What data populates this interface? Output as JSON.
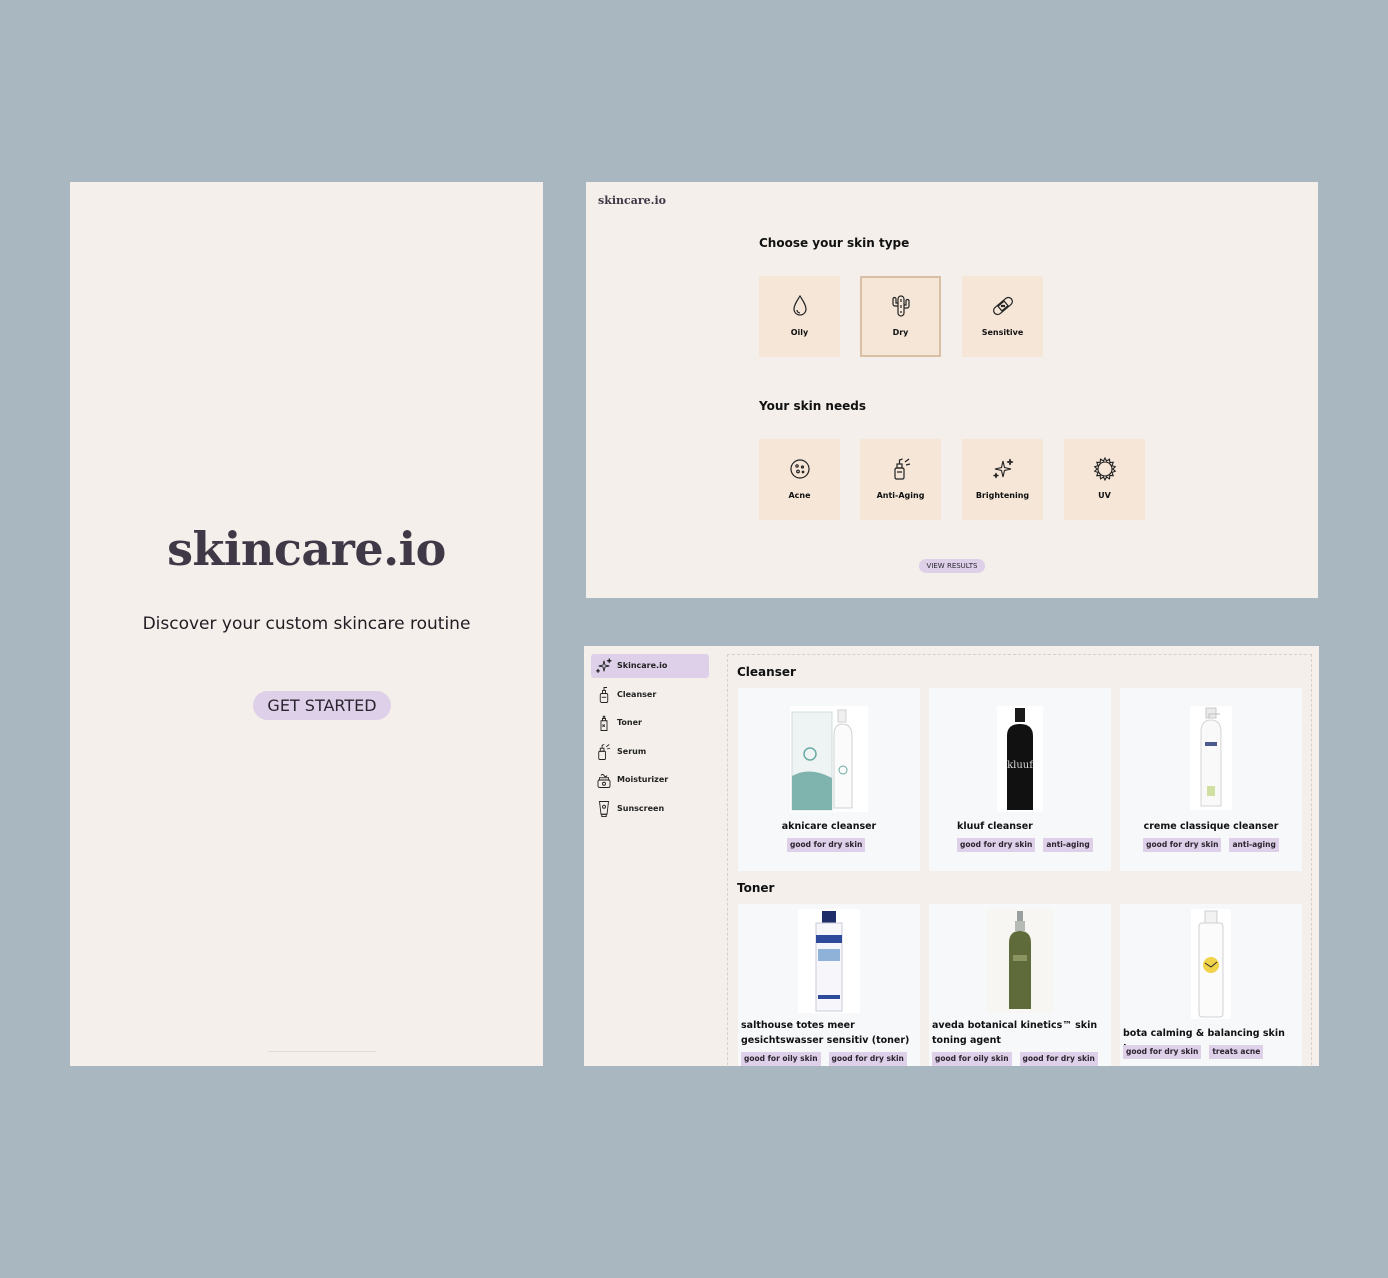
{
  "landing": {
    "logo": "skincare.io",
    "tagline": "Discover your custom skincare routine",
    "cta_label": "GET STARTED"
  },
  "quiz": {
    "brand": "skincare.io",
    "skin_type_heading": "Choose your skin type",
    "skin_types": [
      {
        "label": "Oily",
        "icon": "droplet-icon",
        "selected": false
      },
      {
        "label": "Dry",
        "icon": "cactus-icon",
        "selected": true
      },
      {
        "label": "Sensitive",
        "icon": "bandage-icon",
        "selected": false
      }
    ],
    "skin_needs_heading": "Your skin needs",
    "skin_needs": [
      {
        "label": "Acne",
        "icon": "acne-icon"
      },
      {
        "label": "Anti-Aging",
        "icon": "dropper-bottle-icon"
      },
      {
        "label": "Brightening",
        "icon": "sparkles-icon"
      },
      {
        "label": "UV",
        "icon": "sun-icon"
      }
    ],
    "view_results_label": "VIEW RESULTS"
  },
  "catalog": {
    "nav": [
      {
        "label": "Skincare.io",
        "icon": "sparkles-icon",
        "active": true
      },
      {
        "label": "Cleanser",
        "icon": "cleanser-bottle-icon"
      },
      {
        "label": "Toner",
        "icon": "toner-bottle-icon"
      },
      {
        "label": "Serum",
        "icon": "serum-dropper-icon"
      },
      {
        "label": "Moisturizer",
        "icon": "moisturizer-jar-icon"
      },
      {
        "label": "Sunscreen",
        "icon": "sunscreen-tube-icon"
      }
    ],
    "sections": [
      {
        "title": "Cleanser",
        "products": [
          {
            "name": "aknicare cleanser",
            "tags": [
              "good for dry skin"
            ]
          },
          {
            "name": "kluuf cleanser",
            "tags": [
              "good for dry skin",
              "anti-aging"
            ]
          },
          {
            "name": "creme classique cleanser",
            "tags": [
              "good for dry skin",
              "anti-aging"
            ]
          }
        ]
      },
      {
        "title": "Toner",
        "products": [
          {
            "name": "salthouse totes meer gesichtswasser sensitiv (toner)",
            "tags": [
              "good for oily skin",
              "good for dry skin"
            ]
          },
          {
            "name": "aveda botanical kinetics™ skin toning agent",
            "tags": [
              "good for oily skin",
              "good for dry skin"
            ]
          },
          {
            "name": "bota calming & balancing skin toner",
            "tags": [
              "good for dry skin",
              "treats acne"
            ]
          }
        ]
      }
    ],
    "product_image_text": {
      "kluuf": "kluuf"
    }
  },
  "colors": {
    "background": "#a9b7c1",
    "panel": "#f4efea",
    "accent_lavender": "#ddd0e8",
    "tile_peach": "#f5e6d8",
    "selected_border": "#d9bfa3",
    "logo": "#3f3847"
  }
}
